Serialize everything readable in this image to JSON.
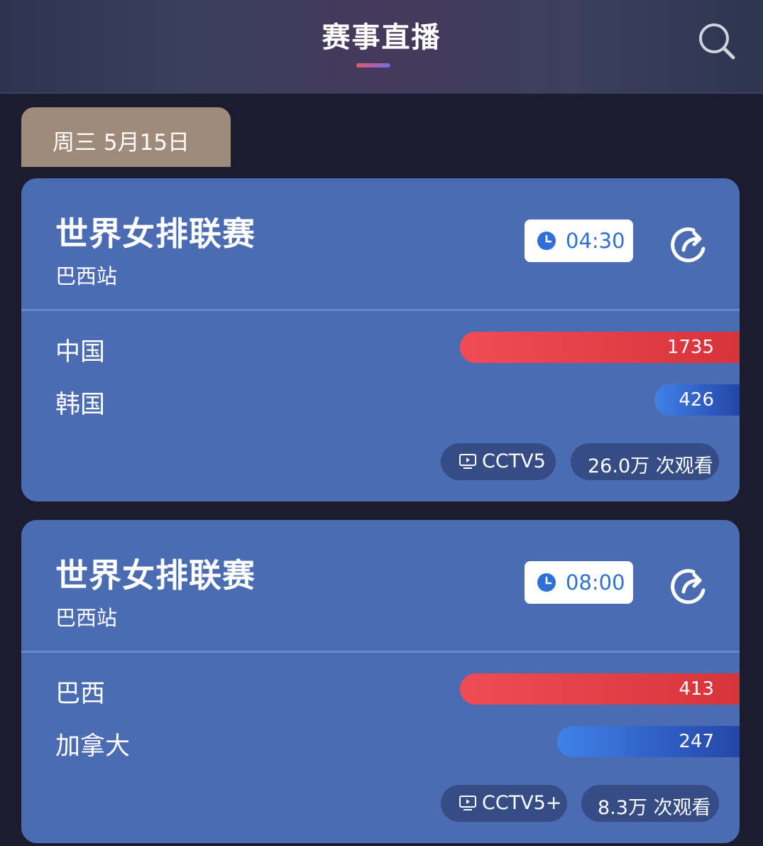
{
  "header": {
    "title": "赛事直播",
    "search_icon": "search-icon"
  },
  "date_tab": "周三 5月15日",
  "colors": {
    "card_bg": "#4b6cb3",
    "home_bar": "#e8414a",
    "away_bar": "#2f63d0",
    "time_text": "#2f6fd8",
    "date_tab_bg": "#a08b7b"
  },
  "matches": [
    {
      "title": "世界女排联赛",
      "subtitle": "巴西站",
      "time": "04:30",
      "teams": [
        {
          "name": "中国",
          "score": "1735"
        },
        {
          "name": "韩国",
          "score": "426"
        }
      ],
      "channel": "CCTV5",
      "views": "26.0万 次观看"
    },
    {
      "title": "世界女排联赛",
      "subtitle": "巴西站",
      "time": "08:00",
      "teams": [
        {
          "name": "巴西",
          "score": "413"
        },
        {
          "name": "加拿大",
          "score": "247"
        }
      ],
      "channel": "CCTV5+",
      "views": "8.3万 次观看"
    }
  ]
}
